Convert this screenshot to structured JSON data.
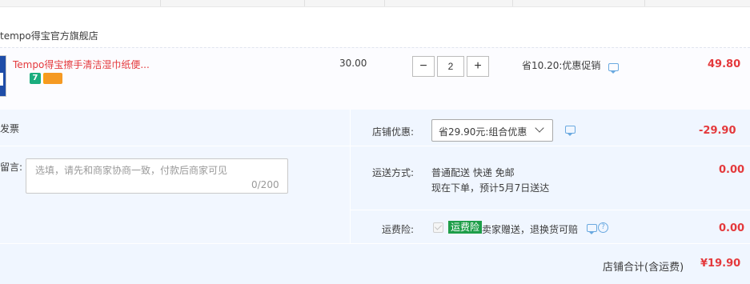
{
  "store": {
    "name": "tempo得宝官方旗舰店"
  },
  "item": {
    "title": "Tempo得宝擦手清洁湿巾纸便...",
    "badge_7": "7",
    "unit_price": "30.00",
    "quantity": "2",
    "qty_minus": "−",
    "qty_plus": "+",
    "promo": "省10.20:优惠促销",
    "subtotal": "49.80"
  },
  "invoice": {
    "label": "发票"
  },
  "message": {
    "label": "留言:",
    "placeholder": "选填，请先和商家协商一致，付款后商家可见",
    "count": "0/200"
  },
  "shop_discount": {
    "label": "店铺优惠:",
    "selected": "省29.90元:组合优惠",
    "amount": "-29.90"
  },
  "shipping": {
    "label": "运送方式:",
    "method": "普通配送 快递 免邮",
    "eta": "现在下单，预计5月7日送达",
    "amount": "0.00"
  },
  "insurance": {
    "label": "运费险:",
    "badge": "运费险",
    "desc": "卖家赠送，退换货可赔",
    "help": "?",
    "amount": "0.00"
  },
  "total": {
    "label": "店铺合计(含运费)",
    "amount": "¥19.90"
  },
  "colors": {
    "price_red": "#e4393c",
    "panel_blue": "#f0f6ff",
    "insurance_green": "#1e9e49",
    "icon_blue": "#6aa9e0"
  }
}
